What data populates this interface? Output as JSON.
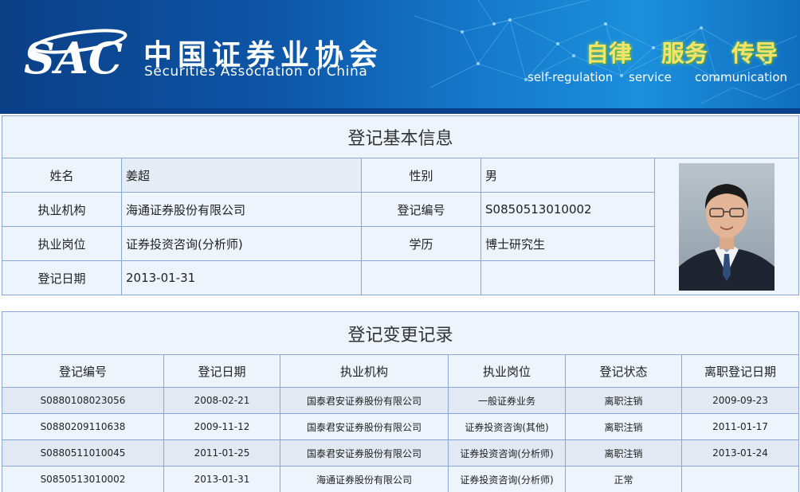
{
  "header": {
    "logo_text": "SAC",
    "org_name_cn": "中国证券业协会",
    "org_name_en": "Securities Association of China",
    "mottos": [
      {
        "cn": "自律",
        "en": "self-regulation"
      },
      {
        "cn": "服务",
        "en": "service"
      },
      {
        "cn": "传导",
        "en": "communication"
      }
    ]
  },
  "basic_info": {
    "title": "登记基本信息",
    "fields": {
      "name_label": "姓名",
      "name_value": "姜超",
      "gender_label": "性别",
      "gender_value": "男",
      "org_label": "执业机构",
      "org_value": "海通证券股份有限公司",
      "reg_no_label": "登记编号",
      "reg_no_value": "S0850513010002",
      "position_label": "执业岗位",
      "position_value": "证券投资咨询(分析师)",
      "education_label": "学历",
      "education_value": "博士研究生",
      "reg_date_label": "登记日期",
      "reg_date_value": "2013-01-31"
    }
  },
  "change_records": {
    "title": "登记变更记录",
    "columns": [
      "登记编号",
      "登记日期",
      "执业机构",
      "执业岗位",
      "登记状态",
      "离职登记日期"
    ],
    "rows": [
      [
        "S0880108023056",
        "2008-02-21",
        "国泰君安证券股份有限公司",
        "一般证券业务",
        "离职注销",
        "2009-09-23"
      ],
      [
        "S0880209110638",
        "2009-11-12",
        "国泰君安证券股份有限公司",
        "证券投资咨询(其他)",
        "离职注销",
        "2011-01-17"
      ],
      [
        "S0880511010045",
        "2011-01-25",
        "国泰君安证券股份有限公司",
        "证券投资咨询(分析师)",
        "离职注销",
        "2013-01-24"
      ],
      [
        "S0850513010002",
        "2013-01-31",
        "海通证券股份有限公司",
        "证券投资咨询(分析师)",
        "正常",
        ""
      ]
    ]
  },
  "colors": {
    "banner_dark": "#0b3f86",
    "banner_light": "#1c8fdc",
    "motto_yellow": "#f3e36a",
    "table_border": "#8aa8d6",
    "cell_bg": "#eef4fb"
  }
}
